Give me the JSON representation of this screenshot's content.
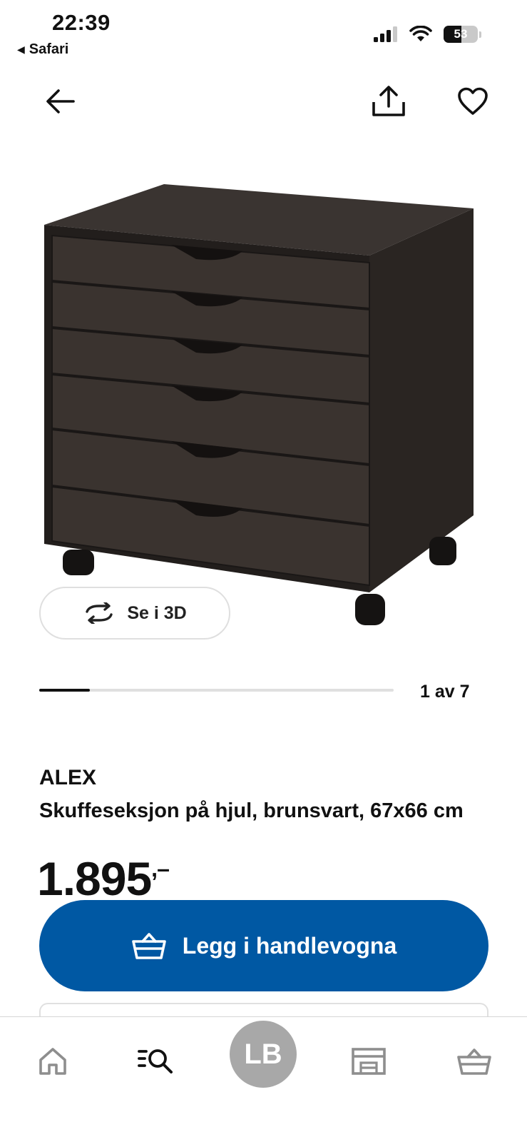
{
  "status_bar": {
    "time": "22:39",
    "back_app": "Safari",
    "battery": "53"
  },
  "icons": {
    "back": "arrow-left-icon",
    "share": "share-icon",
    "favorite": "heart-icon",
    "rotate": "rotate-3d-icon",
    "cart": "basket-icon",
    "home": "home-icon",
    "search": "search-list-icon",
    "store": "store-icon"
  },
  "product": {
    "view3d_label": "Se i 3D",
    "carousel": {
      "counter": "1 av 7",
      "position": 1,
      "total": 7
    },
    "name": "ALEX",
    "description": "Skuffeseksjon på hjul, brunsvart, 67x66 cm",
    "price": "1.895",
    "price_suffix": ",–"
  },
  "actions": {
    "add_to_cart_label": "Legg i handlevogna"
  },
  "tabbar": {
    "profile_initials": "LB"
  },
  "colors": {
    "primary": "#0058a3",
    "profile_bg": "#a8a8a8",
    "furniture": "#2f2a27"
  }
}
